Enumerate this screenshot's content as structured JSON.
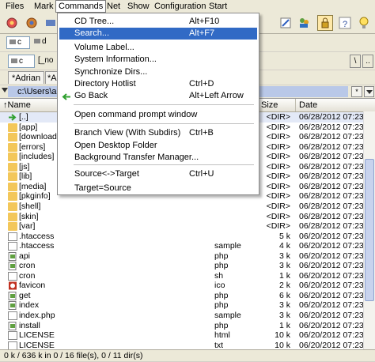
{
  "menubar": [
    "Files",
    "Mark",
    "Commands",
    "Net",
    "Show",
    "Configuration",
    "Start"
  ],
  "drives": {
    "left": "c",
    "right": "d"
  },
  "combo": {
    "left_drive": "c",
    "left_label": "[_no",
    "right_btn1": "\\",
    "right_btn2": ".."
  },
  "tabs": {
    "left1": "*Adrian",
    "left2": "*A"
  },
  "path": "c:\\Users\\a",
  "columns": {
    "name": "Name",
    "size": "Size",
    "date": "Date"
  },
  "sort_indicator": "↑",
  "files": [
    {
      "name": "[..]",
      "ext": "",
      "size": "<DIR>",
      "date": "06/28/2012 07:23",
      "type": "up"
    },
    {
      "name": "[app]",
      "ext": "",
      "size": "<DIR>",
      "date": "06/28/2012 07:23",
      "type": "folder"
    },
    {
      "name": "[download",
      "ext": "",
      "size": "<DIR>",
      "date": "06/28/2012 07:23",
      "type": "folder"
    },
    {
      "name": "[errors]",
      "ext": "",
      "size": "<DIR>",
      "date": "06/28/2012 07:23",
      "type": "folder"
    },
    {
      "name": "[includes]",
      "ext": "",
      "size": "<DIR>",
      "date": "06/28/2012 07:23",
      "type": "folder"
    },
    {
      "name": "[js]",
      "ext": "",
      "size": "<DIR>",
      "date": "06/28/2012 07:23",
      "type": "folder"
    },
    {
      "name": "[lib]",
      "ext": "",
      "size": "<DIR>",
      "date": "06/28/2012 07:23",
      "type": "folder"
    },
    {
      "name": "[media]",
      "ext": "",
      "size": "<DIR>",
      "date": "06/28/2012 07:23",
      "type": "folder"
    },
    {
      "name": "[pkginfo]",
      "ext": "",
      "size": "<DIR>",
      "date": "06/28/2012 07:23",
      "type": "folder"
    },
    {
      "name": "[shell]",
      "ext": "",
      "size": "<DIR>",
      "date": "06/28/2012 07:23",
      "type": "folder"
    },
    {
      "name": "[skin]",
      "ext": "",
      "size": "<DIR>",
      "date": "06/28/2012 07:23",
      "type": "folder"
    },
    {
      "name": "[var]",
      "ext": "",
      "size": "<DIR>",
      "date": "06/28/2012 07:23",
      "type": "folder"
    },
    {
      "name": ".htaccess",
      "ext": "",
      "size": "5 k",
      "date": "06/20/2012 07:23",
      "type": "file"
    },
    {
      "name": ".htaccess",
      "ext": "sample",
      "size": "4 k",
      "date": "06/20/2012 07:23",
      "type": "file"
    },
    {
      "name": "api",
      "ext": "php",
      "size": "3 k",
      "date": "06/20/2012 07:23",
      "type": "php"
    },
    {
      "name": "cron",
      "ext": "php",
      "size": "3 k",
      "date": "06/20/2012 07:23",
      "type": "php"
    },
    {
      "name": "cron",
      "ext": "sh",
      "size": "1 k",
      "date": "06/20/2012 07:23",
      "type": "file"
    },
    {
      "name": "favicon",
      "ext": "ico",
      "size": "2 k",
      "date": "06/20/2012 07:23",
      "type": "ico"
    },
    {
      "name": "get",
      "ext": "php",
      "size": "6 k",
      "date": "06/20/2012 07:23",
      "type": "php"
    },
    {
      "name": "index",
      "ext": "php",
      "size": "3 k",
      "date": "06/20/2012 07:23",
      "type": "php"
    },
    {
      "name": "index.php",
      "ext": "sample",
      "size": "3 k",
      "date": "06/20/2012 07:23",
      "type": "file"
    },
    {
      "name": "install",
      "ext": "php",
      "size": "1 k",
      "date": "06/20/2012 07:23",
      "type": "php"
    },
    {
      "name": "LICENSE",
      "ext": "html",
      "size": "10 k",
      "date": "06/20/2012 07:23",
      "type": "file"
    },
    {
      "name": "LICENSE",
      "ext": "txt",
      "size": "10 k",
      "date": "06/20/2012 07:23",
      "type": "file"
    }
  ],
  "status": "0 k / 636 k in 0 / 16 file(s), 0 / 11 dir(s)",
  "commands_menu": [
    {
      "label": "CD Tree...",
      "shortcut": "Alt+F10"
    },
    {
      "label": "Search...",
      "shortcut": "Alt+F7",
      "highlighted": true
    },
    {
      "label": "Volume Label...",
      "shortcut": ""
    },
    {
      "label": "System Information...",
      "shortcut": ""
    },
    {
      "label": "Synchronize Dirs...",
      "shortcut": ""
    },
    {
      "label": "Directory Hotlist",
      "shortcut": "Ctrl+D"
    },
    {
      "label": "Go Back",
      "shortcut": "Alt+Left Arrow",
      "icon": "back-arrow-icon"
    },
    {
      "label": "Open command prompt window",
      "shortcut": ""
    },
    {
      "label": "Branch View (With Subdirs)",
      "shortcut": "Ctrl+B"
    },
    {
      "label": "Open Desktop Folder",
      "shortcut": ""
    },
    {
      "label": "Background Transfer Manager...",
      "shortcut": ""
    },
    {
      "label": "Source<->Target",
      "shortcut": "Ctrl+U"
    },
    {
      "label": "Target=Source",
      "shortcut": ""
    }
  ],
  "colors": {
    "highlight": "#316ac5",
    "folder": "#f3c75a",
    "path_bg": "#b9c8e8"
  }
}
